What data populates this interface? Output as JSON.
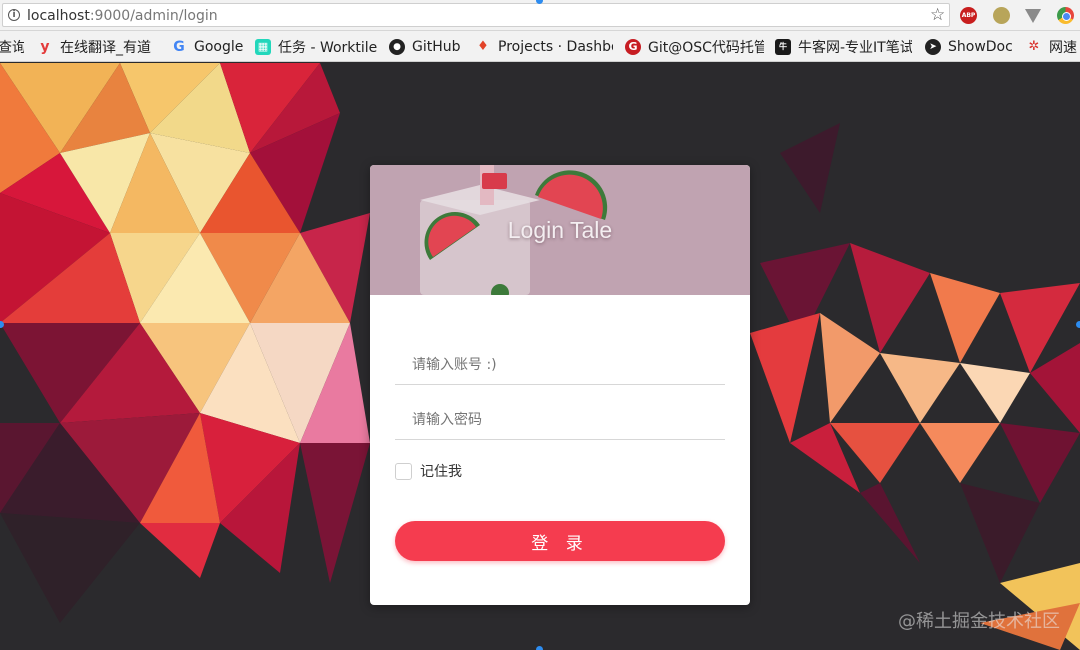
{
  "browser": {
    "url_host": "localhost",
    "url_rest": ":9000/admin/login",
    "extensions": [
      "abp-icon",
      "extension-dot-icon",
      "vue-devtools-icon",
      "chrome-icon"
    ]
  },
  "bookmarks": [
    {
      "label": "查询",
      "icon": "search-icon",
      "color": "#666666"
    },
    {
      "label": "在线翻译_有道",
      "icon": "youdao-icon",
      "color": "#e33b3b"
    },
    {
      "label": "Google",
      "icon": "google-icon",
      "color": "#4285f4"
    },
    {
      "label": "任务 - Worktile",
      "icon": "worktile-icon",
      "color": "#22d7bb"
    },
    {
      "label": "GitHub",
      "icon": "github-icon",
      "color": "#222222"
    },
    {
      "label": "Projects · Dashboard",
      "icon": "gitlab-icon",
      "color": "#e24329"
    },
    {
      "label": "Git@OSC代码托管",
      "icon": "gitosc-icon",
      "color": "#c71d23"
    },
    {
      "label": "牛客网-专业IT笔试",
      "icon": "nowcoder-icon",
      "color": "#1a1a1a"
    },
    {
      "label": "ShowDoc",
      "icon": "showdoc-icon",
      "color": "#222222"
    },
    {
      "label": "网速",
      "icon": "speedtest-icon",
      "color": "#d9312b"
    }
  ],
  "login": {
    "title": "Login Tale",
    "username_placeholder": "请输入账号 :)",
    "password_placeholder": "请输入密码",
    "remember_label": "记住我",
    "submit_label": "登 录",
    "remember_checked": false
  },
  "watermark": "@稀土掘金技术社区",
  "colors": {
    "primary": "#f53c4f",
    "hero": "#c0a3b1",
    "background": "#2a2a2c"
  }
}
